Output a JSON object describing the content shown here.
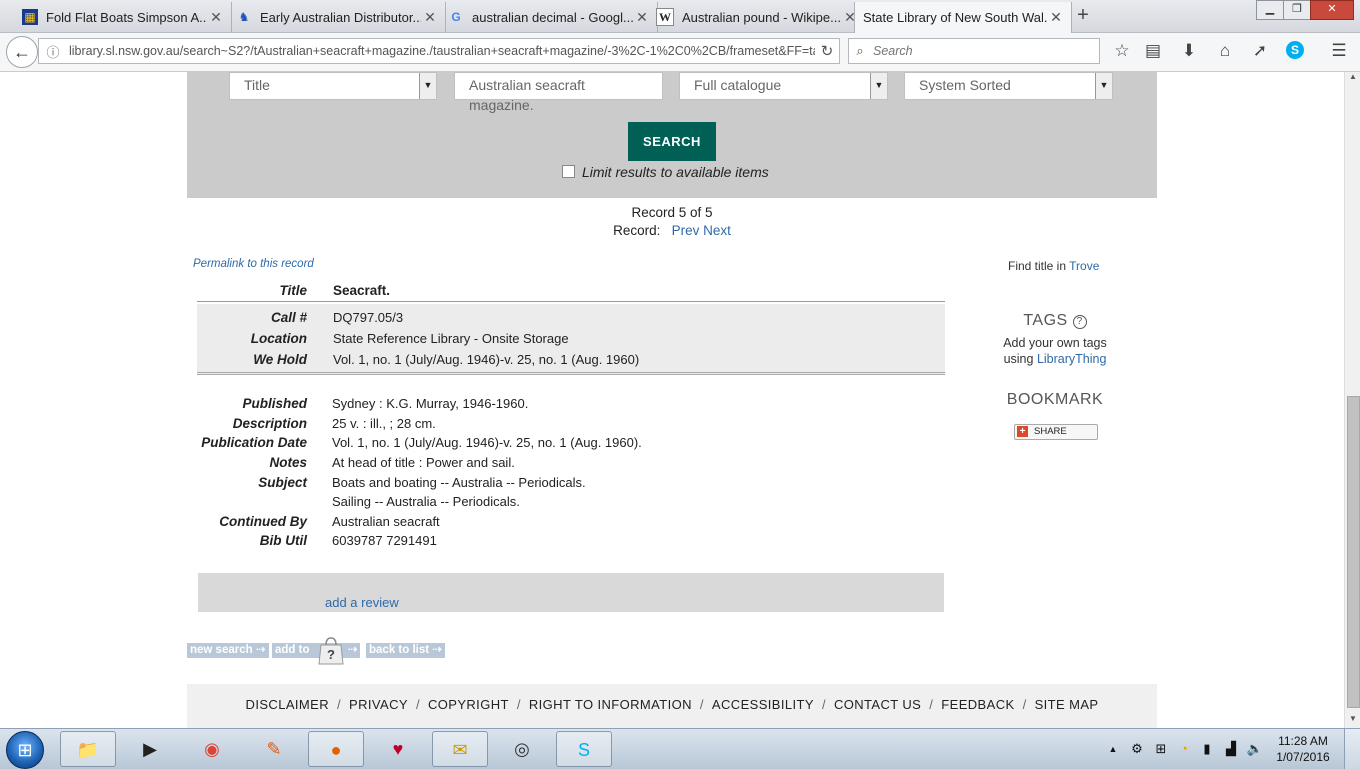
{
  "browser": {
    "tabs": [
      {
        "label": "Fold Flat Boats Simpson A...",
        "icon": "auction-favicon"
      },
      {
        "label": "Early Australian Distributor...",
        "icon": "runner-favicon"
      },
      {
        "label": "australian decimal - Googl...",
        "icon": "google-favicon"
      },
      {
        "label": "Australian pound - Wikipe...",
        "icon": "wikipedia-favicon"
      },
      {
        "label": "State Library of New South Wal...",
        "icon": "sl-favicon",
        "active": true
      }
    ],
    "url": "library.sl.nsw.gov.au/search~S2?/tAustralian+seacraft+magazine./taustralian+seacraft+magazine/-3%2C-1%2C0%2CB/frameset&FF=ta",
    "search_placeholder": "Search"
  },
  "search_form": {
    "field_type": "Title",
    "query": "Australian seacraft magazine.",
    "scope": "Full catalogue",
    "sort": "System Sorted",
    "search_button": "SEARCH",
    "limit_label": "Limit results to available items"
  },
  "record_nav": {
    "position": "Record 5 of 5",
    "record_label": "Record:",
    "prev": "Prev",
    "next": "Next"
  },
  "permalink": "Permalink to this record",
  "record": {
    "title_label": "Title",
    "title": "Seacraft.",
    "holdings": [
      {
        "label": "Call #",
        "value": "DQ797.05/3",
        "link": false
      },
      {
        "label": "Location",
        "value": "State Reference Library - Onsite Storage",
        "link": true
      },
      {
        "label": "We Hold",
        "value": "Vol. 1, no. 1 (July/Aug. 1946)-v. 25, no. 1 (Aug. 1960)",
        "link": false
      }
    ],
    "fields": [
      {
        "label": "Published",
        "value": "Sydney : K.G. Murray, 1946-1960.",
        "link": false
      },
      {
        "label": "Description",
        "value": "25 v. : ill., ; 28 cm.",
        "link": false
      },
      {
        "label": "Publication Date",
        "value": "Vol. 1, no. 1 (July/Aug. 1946)-v. 25, no. 1 (Aug. 1960).",
        "link": false
      },
      {
        "label": "Notes",
        "value": "At head of title : Power and sail.",
        "link": false
      },
      {
        "label": "Subject",
        "value": "Boats and boating -- Australia -- Periodicals.",
        "link": true
      },
      {
        "label": "",
        "value": "Sailing -- Australia -- Periodicals.",
        "link": true
      },
      {
        "label": "Continued By",
        "value": "Australian seacraft",
        "link": true
      },
      {
        "label": "Bib Util",
        "value": "6039787 7291491",
        "link": false
      }
    ]
  },
  "review_link": "add a review",
  "buttons": {
    "new_search": "new search",
    "add_to": "add to",
    "back_to_list": "back to list"
  },
  "sidebar": {
    "find_title": "Find title in",
    "trove": "Trove",
    "tags_heading": "TAGS",
    "tags_line1": "Add your own tags",
    "tags_using": "using",
    "library_thing": "LibraryThing",
    "bookmark_heading": "BOOKMARK",
    "share": "SHARE"
  },
  "footer": [
    "DISCLAIMER",
    "PRIVACY",
    "COPYRIGHT",
    "RIGHT TO INFORMATION",
    "ACCESSIBILITY",
    "CONTACT US",
    "FEEDBACK",
    "SITE MAP"
  ],
  "taskbar": {
    "apps": [
      "file-explorer-icon",
      "media-player-icon",
      "chrome-icon",
      "paint-icon",
      "firefox-icon",
      "heart-app-icon",
      "outlook-icon",
      "media-icon",
      "skype-icon"
    ],
    "time": "11:28 AM",
    "date": "1/07/2016"
  },
  "colors": {
    "search_button": "#006056",
    "panel": "#cbcbcb",
    "link": "#2e6aa8"
  }
}
